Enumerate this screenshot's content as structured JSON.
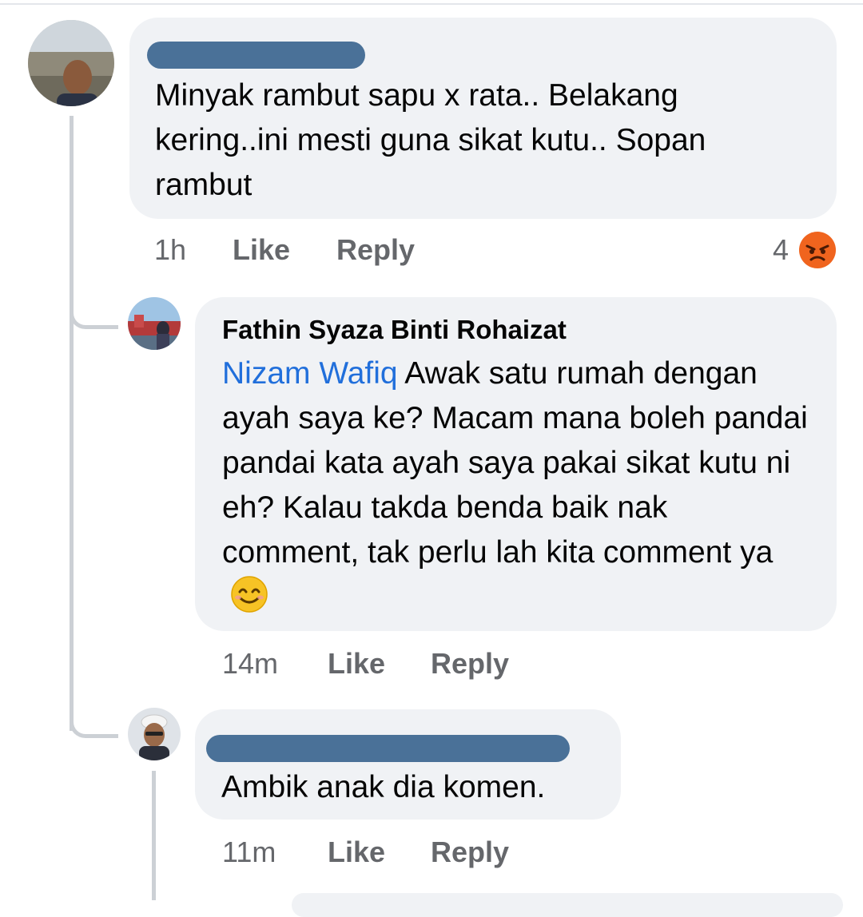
{
  "comments": [
    {
      "author": "",
      "author_redacted": true,
      "text": "Minyak rambut sapu x rata.. Belakang kering..ini mesti guna sikat kutu.. Sopan rambut",
      "time": "1h",
      "like_label": "Like",
      "reply_label": "Reply",
      "reaction_count": "4",
      "reaction_icon": "angry-face-icon"
    },
    {
      "author": "Fathin Syaza Binti Rohaizat",
      "mention": "Nizam Wafiq",
      "text": " Awak satu rumah dengan ayah saya ke? Macam mana boleh pandai pandai kata ayah saya pakai sikat kutu ni eh? Kalau takda benda baik nak comment, tak perlu lah kita comment ya",
      "emoji": "smiling-face-icon",
      "time": "14m",
      "like_label": "Like",
      "reply_label": "Reply"
    },
    {
      "author": "",
      "author_redacted": true,
      "text": "Ambik anak dia komen.",
      "time": "11m",
      "like_label": "Like",
      "reply_label": "Reply"
    }
  ],
  "colors": {
    "bubble": "#f0f2f5",
    "mention": "#216fdb",
    "meta": "#65676b",
    "redaction": "#4a7198",
    "angry": "#f0641e"
  }
}
